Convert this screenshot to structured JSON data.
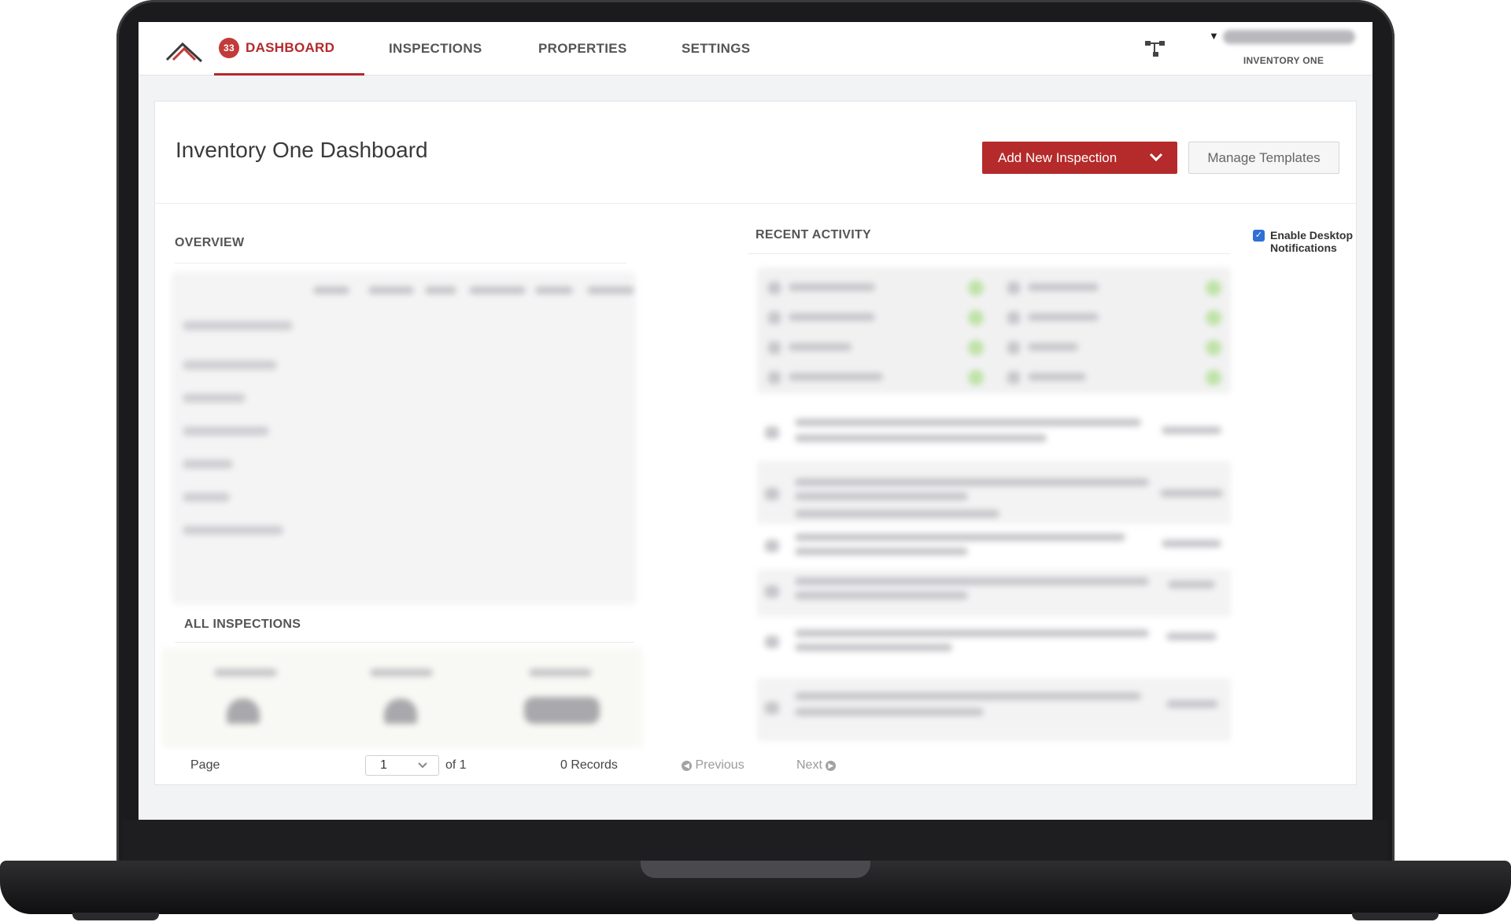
{
  "nav": {
    "badge_count": "33",
    "dashboard": "DASHBOARD",
    "inspections": "INSPECTIONS",
    "properties": "PROPERTIES",
    "settings": "SETTINGS",
    "org_name": "INVENTORY ONE"
  },
  "header": {
    "title": "Inventory One Dashboard",
    "add_button": "Add New Inspection",
    "manage_button": "Manage Templates"
  },
  "overview": {
    "label": "OVERVIEW"
  },
  "recent_activity": {
    "label": "RECENT ACTIVITY",
    "notifications_label": "Enable Desktop Notifications",
    "notifications_checked": true
  },
  "all_inspections": {
    "label": "ALL INSPECTIONS"
  },
  "pagination": {
    "page_label": "Page",
    "current_page": "1",
    "of_total": "of 1",
    "records": "0 Records",
    "previous": "Previous",
    "next": "Next"
  },
  "colors": {
    "accent": "#b52a2a",
    "checkbox": "#2f6fd6"
  }
}
